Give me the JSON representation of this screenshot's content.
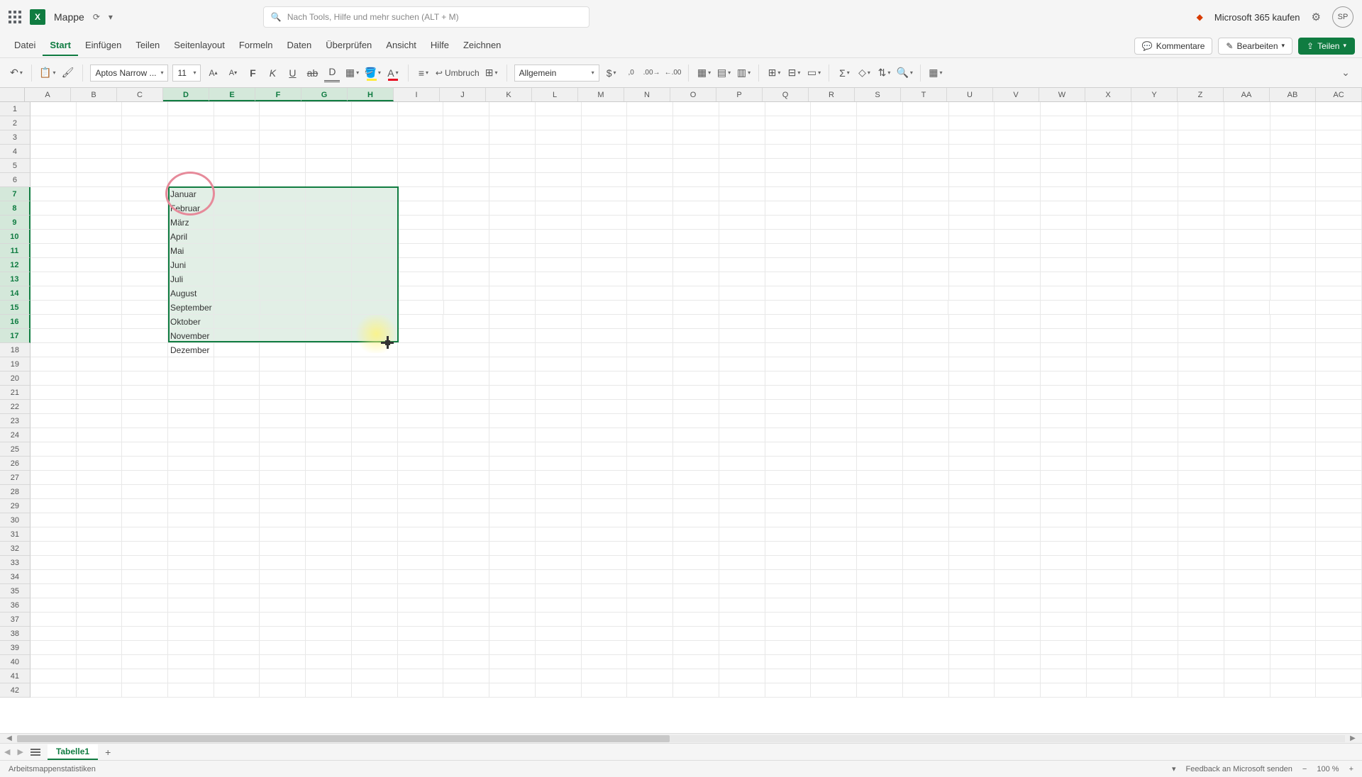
{
  "title": {
    "doc_name": "Mappe",
    "search_placeholder": "Nach Tools, Hilfe und mehr suchen (ALT + M)",
    "m365_label": "Microsoft 365 kaufen",
    "avatar": "SP"
  },
  "menu": {
    "items": [
      "Datei",
      "Start",
      "Einfügen",
      "Teilen",
      "Seitenlayout",
      "Formeln",
      "Daten",
      "Überprüfen",
      "Ansicht",
      "Hilfe",
      "Zeichnen"
    ],
    "active_index": 1,
    "comments": "Kommentare",
    "editing": "Bearbeiten",
    "share": "Teilen"
  },
  "ribbon": {
    "font_name": "Aptos Narrow ...",
    "font_size": "11",
    "wrap_label": "Umbruch",
    "number_format": "Allgemein"
  },
  "columns": [
    "A",
    "B",
    "C",
    "D",
    "E",
    "F",
    "G",
    "H",
    "I",
    "J",
    "K",
    "L",
    "M",
    "N",
    "O",
    "P",
    "Q",
    "R",
    "S",
    "T",
    "U",
    "V",
    "W",
    "X",
    "Y",
    "Z",
    "AA",
    "AB",
    "AC"
  ],
  "selected_cols": [
    "D",
    "E",
    "F",
    "G",
    "H"
  ],
  "row_count": 42,
  "selected_rows": [
    7,
    8,
    9,
    10,
    11,
    12,
    13,
    14,
    15,
    16,
    17
  ],
  "cells": {
    "D7": "Januar",
    "D8": "Februar",
    "D9": "März",
    "D10": "April",
    "D11": "Mai",
    "D12": "Juni",
    "D13": "Juli",
    "D14": "August",
    "D15": "September",
    "D16": "Oktober",
    "D17": "November",
    "D18": "Dezember"
  },
  "selection": {
    "top_row": 7,
    "bottom_row": 17,
    "left_col": "D",
    "right_col": "H"
  },
  "sheet": {
    "name": "Tabelle1"
  },
  "status": {
    "left": "Arbeitsmappenstatistiken",
    "feedback": "Feedback an Microsoft senden",
    "zoom": "100 %"
  }
}
